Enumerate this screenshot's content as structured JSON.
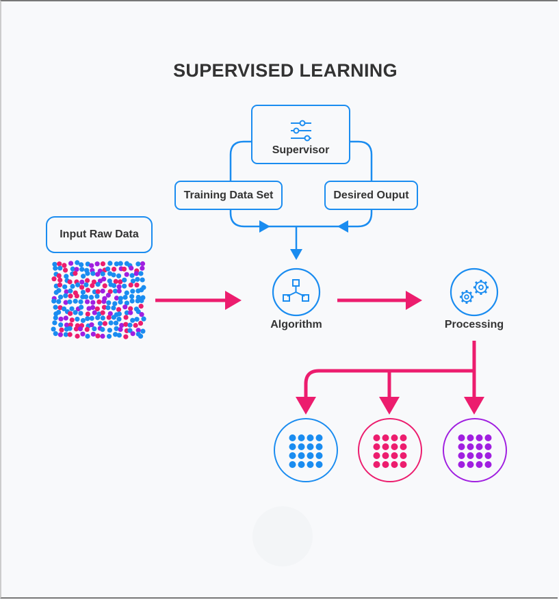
{
  "title": "SUPERVISED LEARNING",
  "nodes": {
    "supervisor": {
      "label": "Supervisor",
      "icon": "sliders-icon"
    },
    "training": {
      "label": "Training Data Set"
    },
    "desired": {
      "label": "Desired Ouput"
    },
    "input": {
      "label": "Input Raw Data"
    },
    "algorithm": {
      "label": "Algorithm",
      "icon": "network-nodes-icon"
    },
    "processing": {
      "label": "Processing",
      "icon": "gears-icon"
    }
  },
  "outputs": [
    {
      "name": "blue-cluster",
      "color": "#1a8cf0"
    },
    {
      "name": "pink-cluster",
      "color": "#ec1d6e"
    },
    {
      "name": "purple-cluster",
      "color": "#a01fe0"
    }
  ],
  "colors": {
    "flow_blue": "#1a8cf0",
    "arrow_pink": "#ec1d6e",
    "dot_purple": "#a01fe0",
    "text": "#333333",
    "background": "#f8f9fb"
  }
}
